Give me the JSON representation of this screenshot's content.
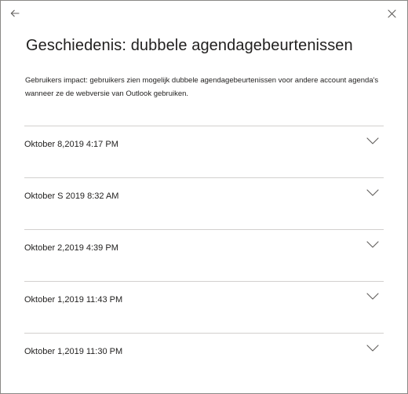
{
  "dialog": {
    "title": "Geschiedenis: dubbele agendagebeurtenissen",
    "description": "Gebruikers impact: gebruikers zien mogelijk dubbele agendagebeurtenissen voor andere account agenda's wanneer ze de webversie van Outlook gebruiken.",
    "icons": {
      "back": "arrow-left-icon",
      "close": "close-icon",
      "expand": "chevron-down-icon"
    },
    "colors": {
      "text": "#201f1e",
      "icon": "#605e5c",
      "divider": "#d2d0ce",
      "border": "#8a8886"
    }
  },
  "history": [
    {
      "date": "Oktober 8,2019 4:17 PM"
    },
    {
      "date": "Oktober S 2019 8:32 AM"
    },
    {
      "date": "Oktober 2,2019 4:39 PM"
    },
    {
      "date": "Oktober 1,2019 11:43 PM"
    },
    {
      "date": "Oktober 1,2019 11:30 PM"
    }
  ]
}
